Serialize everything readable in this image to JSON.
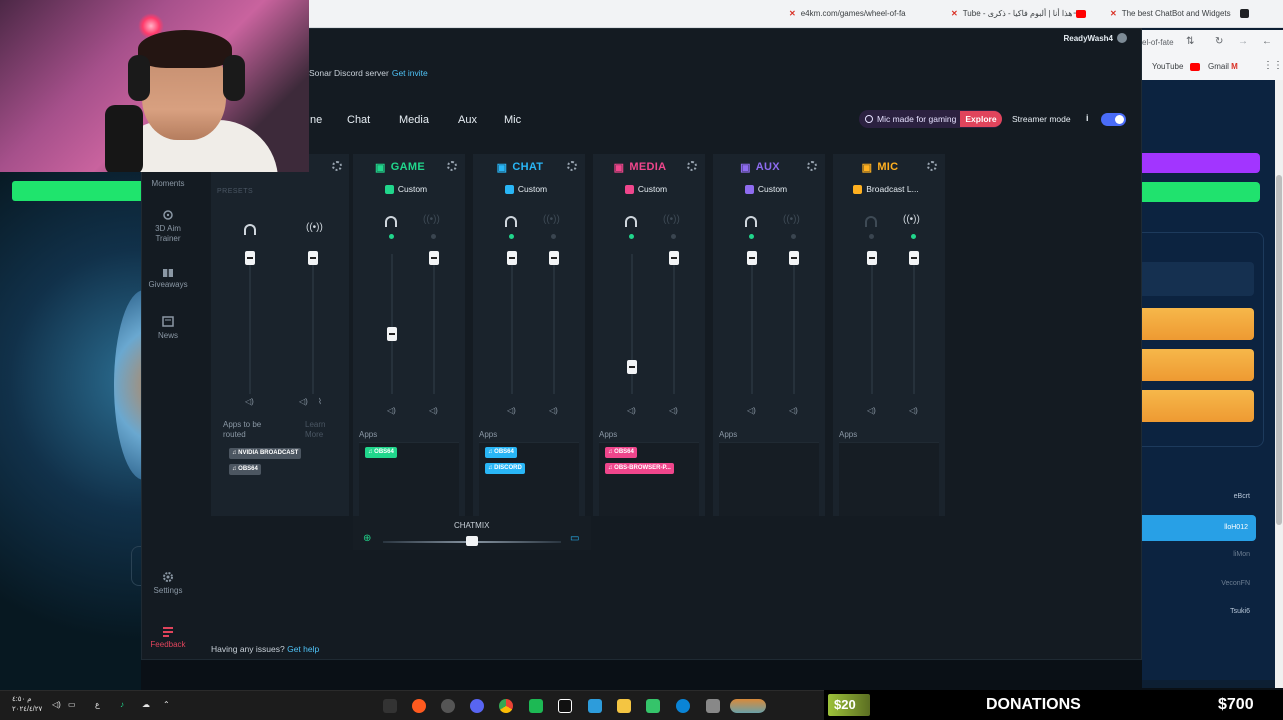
{
  "browser": {
    "tab_active": "e4km.com/games/wheel-of-fa",
    "tab_youtube": "Tube - هذا أنا | ألبوم فاكيا - ذكرى",
    "tab_chatbot": "The best ChatBot and Widgets",
    "toolbar_url": "el-of-fate",
    "bookmark_youtube": "YouTube",
    "bookmark_gmail": "Gmail"
  },
  "background_site": {
    "list_items": [
      "eBcrt",
      "lloH012",
      "liMon",
      "VeconFN",
      "Tsuki6"
    ],
    "active_index": 1
  },
  "app": {
    "user": "ReadyWash4",
    "discord_text": "Sonar Discord server",
    "discord_link": "Get invite",
    "nav_tabs": [
      "ne",
      "Chat",
      "Media",
      "Aux",
      "Mic"
    ],
    "mic_chip_text": "Mic made for gaming",
    "mic_chip_action": "Explore",
    "streamer_mode": "Streamer mode",
    "info_label": "i",
    "sidebar": [
      {
        "label": "Moments",
        "icon": "moments-icon"
      },
      {
        "label": "3D Aim Trainer",
        "icon": "target-icon"
      },
      {
        "label": "Giveaways",
        "icon": "gift-icon"
      },
      {
        "label": "News",
        "icon": "news-icon"
      },
      {
        "label": "Settings",
        "icon": "gear-icon"
      },
      {
        "label": "Feedback",
        "icon": "feedback-icon"
      }
    ],
    "presets_label": "PRESETS",
    "master": {
      "apps_label": "Apps to be routed",
      "learn_more": "Learn More",
      "apps": [
        "NVIDIA BROADCAST",
        "OBS64"
      ]
    },
    "channels": [
      {
        "name": "GAME",
        "preset": "Custom",
        "color": "#21d68c",
        "apps_label": "Apps",
        "apps": [
          "OBS64"
        ]
      },
      {
        "name": "CHAT",
        "preset": "Custom",
        "color": "#29b6f6",
        "apps_label": "Apps",
        "apps": [
          "OBS64",
          "DISCORD"
        ]
      },
      {
        "name": "MEDIA",
        "preset": "Custom",
        "color": "#f0468c",
        "apps_label": "Apps",
        "apps": [
          "OBS64",
          "OBS-BROWSER-P..."
        ]
      },
      {
        "name": "AUX",
        "preset": "Custom",
        "color": "#8e6cf0",
        "apps_label": "Apps",
        "apps": []
      },
      {
        "name": "MIC",
        "preset": "Broadcast L...",
        "color": "#ffb020",
        "apps_label": "Apps",
        "apps": []
      }
    ],
    "chatmix_label": "CHATMIX",
    "chatmix_level": 0.5,
    "help_text": "Having any issues?",
    "help_link": "Get help"
  },
  "taskbar": {
    "clock_time": "م ٤:٥٠",
    "clock_date": "٢٠٢٤/٤/٢٧",
    "lang": "ع"
  },
  "donations": {
    "current": "$20",
    "label": "DONATIONS",
    "goal": "$700"
  }
}
